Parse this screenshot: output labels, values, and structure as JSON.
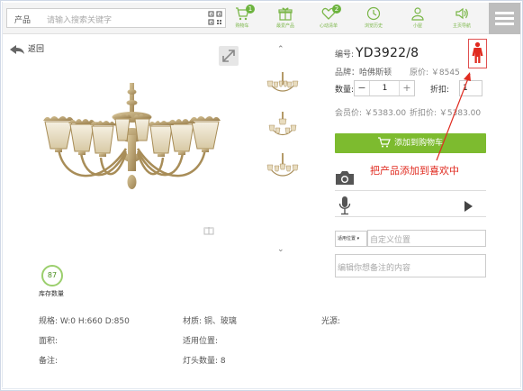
{
  "search": {
    "category": "产品",
    "placeholder": "请输入搜索关键字"
  },
  "nav": [
    {
      "label": "购物车",
      "badge": "1",
      "icon": "cart-icon"
    },
    {
      "label": "最爱产品",
      "badge": "",
      "icon": "gift-box-icon"
    },
    {
      "label": "心动清单",
      "badge": "2",
      "icon": "heart-icon"
    },
    {
      "label": "浏览历史",
      "badge": "",
      "icon": "clock-icon"
    },
    {
      "label": "小屋",
      "badge": "",
      "icon": "user-icon"
    },
    {
      "label": "主页导航",
      "badge": "",
      "icon": "speaker-icon"
    }
  ],
  "back_label": "返回",
  "product": {
    "sku_label": "编号:",
    "sku": "YD3922/8",
    "brand": "品牌：哈佛斯顿",
    "original_price": "原价: ￥8545",
    "quantity_label": "数量:",
    "quantity": "1",
    "discount_label": "折扣:",
    "discount": "1",
    "member_price": "会员价: ￥5383.00",
    "discount_price": "折扣价: ￥5383.00",
    "add_cart_label": "添加到购物车",
    "stock_count": "87",
    "stock_label": "库存数量"
  },
  "annotation": "把产品添加到喜欢中",
  "location": {
    "select_value": "适用位置",
    "placeholder": "自定义位置"
  },
  "note_placeholder": "编辑你想备注的内容",
  "specs": {
    "size": "规格:  W:0 H:660 D:850",
    "material": "材质:  铜、玻璃",
    "light": "光源:",
    "area": "面积:",
    "position": "适用位置:",
    "remark": "备注:",
    "head_count": "灯头数量: 8"
  },
  "colors": {
    "accent_green": "#7dbb2f",
    "annotation_red": "#e02b20"
  }
}
